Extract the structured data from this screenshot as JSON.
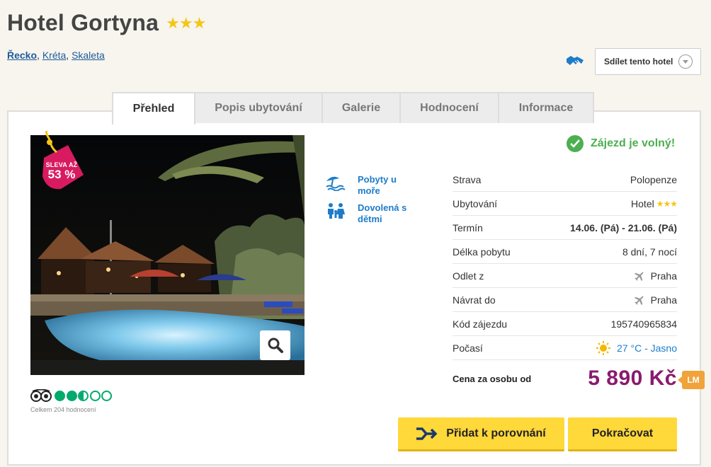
{
  "hotel": {
    "name": "Hotel Gortyna",
    "stars": "★★★"
  },
  "breadcrumb": {
    "country": "Řecko",
    "region": "Kréta",
    "city": "Skaleta",
    "sep": ", "
  },
  "share": {
    "label": "Sdílet tento hotel"
  },
  "tabs": [
    {
      "label": "Přehled"
    },
    {
      "label": "Popis ubytování"
    },
    {
      "label": "Galerie"
    },
    {
      "label": "Hodnocení"
    },
    {
      "label": "Informace"
    }
  ],
  "badge": {
    "line1": "SLEVA AŽ",
    "line2": "53 %"
  },
  "tripadvisor": {
    "rating": 2.5,
    "max": 5,
    "count_text": "Celkem 204 hodnocení"
  },
  "features": [
    {
      "label": "Pobyty u moře",
      "icon": "beach-icon"
    },
    {
      "label": "Dovolená s dětmi",
      "icon": "family-icon"
    }
  ],
  "status": {
    "text": "Zájezd je volný!"
  },
  "info": {
    "strava": {
      "label": "Strava",
      "value": "Polopenze"
    },
    "ubytovani": {
      "label": "Ubytování",
      "value": "Hotel",
      "stars": "★★★"
    },
    "termin": {
      "label": "Termín",
      "value": "14.06. (Pá) - 21.06. (Pá)"
    },
    "delka": {
      "label": "Délka pobytu",
      "value": "8 dní, 7 nocí"
    },
    "odlet": {
      "label": "Odlet z",
      "value": "Praha"
    },
    "navrat": {
      "label": "Návrat do",
      "value": "Praha"
    },
    "kod": {
      "label": "Kód zájezdu",
      "value": "195740965834"
    },
    "pocasi": {
      "label": "Počasí",
      "value": "27 °C - Jasno"
    }
  },
  "price": {
    "label": "Cena za osobu od",
    "value": "5 890 Kč",
    "badge": "LM"
  },
  "buttons": {
    "compare": "Přidat k porovnání",
    "continue": "Pokračovat"
  },
  "colors": {
    "accent_yellow": "#ffd83a",
    "price_purple": "#8a1b6e",
    "link_blue": "#1d7cc9",
    "ok_green": "#4caf50",
    "badge_pink": "#d81b60",
    "lm_orange": "#f0a33a"
  }
}
